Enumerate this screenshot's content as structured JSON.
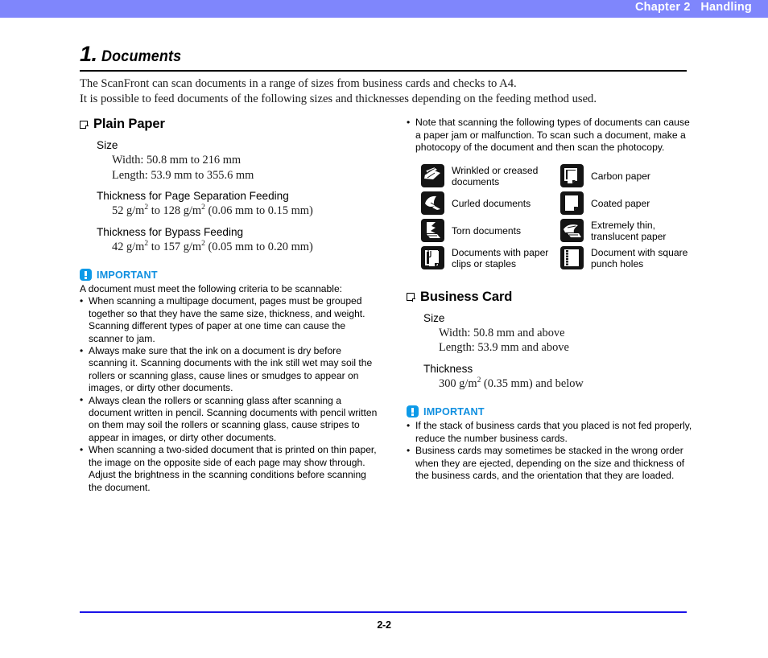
{
  "header": {
    "running_head": "Chapter 2   Handling",
    "band_color": "#7f86fc"
  },
  "title": {
    "number": "1.",
    "name": "Documents"
  },
  "intro": {
    "line1": "The ScanFront can scan documents in a range of sizes from business cards and checks to A4.",
    "line2": "It is possible to feed documents of the following sizes and thicknesses depending on the feeding method used."
  },
  "plain_paper": {
    "heading": "Plain Paper",
    "size_label": "Size",
    "size_width": "Width: 50.8 mm to 216 mm",
    "size_length": "Length: 53.9 mm to 355.6 mm",
    "sep_label": "Thickness for Page Separation Feeding",
    "sep_value_a": "52 g/m",
    "sep_value_sup1": "2",
    "sep_value_b": " to 128 g/m",
    "sep_value_sup2": "2",
    "sep_value_c": " (0.06 mm to 0.15 mm)",
    "bypass_label": "Thickness for Bypass Feeding",
    "bypass_value_a": "42 g/m",
    "bypass_value_sup1": "2",
    "bypass_value_b": " to 157 g/m",
    "bypass_value_sup2": "2",
    "bypass_value_c": " (0.05 mm to 0.20 mm)"
  },
  "important_left": {
    "title": "IMPORTANT",
    "lead": "A document must meet the following criteria to be scannable:",
    "items": [
      "When scanning a multipage document, pages must be grouped together so that they have the same size, thickness, and weight. Scanning different types of paper at one time can cause the scanner to jam.",
      "Always make sure that the ink on a document is dry before scanning it. Scanning documents with the ink still wet may soil the rollers or scanning glass, cause lines or smudges to appear on images, or dirty other documents.",
      "Always clean the rollers or scanning glass after scanning a document written in pencil. Scanning documents with pencil written on them may soil the rollers or scanning glass, cause stripes to appear in images, or dirty other documents.",
      "When scanning a two-sided document that is printed on thin paper, the image on the opposite side of each page may show through. Adjust the brightness in the scanning conditions before scanning the document."
    ]
  },
  "note_right": {
    "items": [
      "Note that scanning the following types of documents can cause a paper jam or malfunction. To scan such a document, make a photocopy of the document and then scan the photocopy."
    ]
  },
  "icon_grid": {
    "rows": [
      {
        "left_icon": "wrinkled-creased-document-icon",
        "left_label": "Wrinkled or creased documents",
        "right_icon": "carbon-paper-icon",
        "right_label": "Carbon paper"
      },
      {
        "left_icon": "curled-document-icon",
        "left_label": "Curled documents",
        "right_icon": "coated-paper-icon",
        "right_label": "Coated paper"
      },
      {
        "left_icon": "torn-document-icon",
        "left_label": "Torn documents",
        "right_icon": "thin-translucent-paper-icon",
        "right_label": "Extremely thin, translucent paper"
      },
      {
        "left_icon": "paper-clip-staple-icon",
        "left_label": "Documents with paper clips or staples",
        "right_icon": "square-punch-holes-icon",
        "right_label": "Document with square punch holes"
      }
    ]
  },
  "business_card": {
    "heading": "Business Card",
    "size_label": "Size",
    "size_width": "Width: 50.8 mm and above",
    "size_length": "Length: 53.9 mm and above",
    "thickness_label": "Thickness",
    "thickness_value_a": "300 g/m",
    "thickness_value_sup": "2",
    "thickness_value_b": " (0.35 mm) and below"
  },
  "important_right": {
    "title": "IMPORTANT",
    "items": [
      "If the stack of business cards that you placed is not fed properly, reduce the number business cards.",
      "Business cards may sometimes be stacked in the wrong order when they are ejected, depending on the size and thickness of the business cards, and the orientation that they are loaded."
    ]
  },
  "footer": {
    "page_number": "2-2",
    "rule_color": "#1a12e8"
  }
}
